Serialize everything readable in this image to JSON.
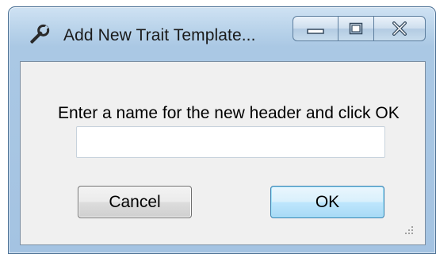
{
  "window": {
    "title": "Add New Trait Template...",
    "icons": {
      "app": "wrench-icon",
      "minimize": "minimize-icon",
      "maximize": "maximize-icon",
      "close": "close-icon"
    }
  },
  "dialog": {
    "prompt": "Enter a name for the new header and click OK",
    "name_input": {
      "value": "",
      "placeholder": ""
    },
    "cancel_label": "Cancel",
    "ok_label": "OK"
  },
  "colors": {
    "frame": "#a4c3e2",
    "client": "#f0f0f0",
    "ok_button": "#bee6fd"
  }
}
